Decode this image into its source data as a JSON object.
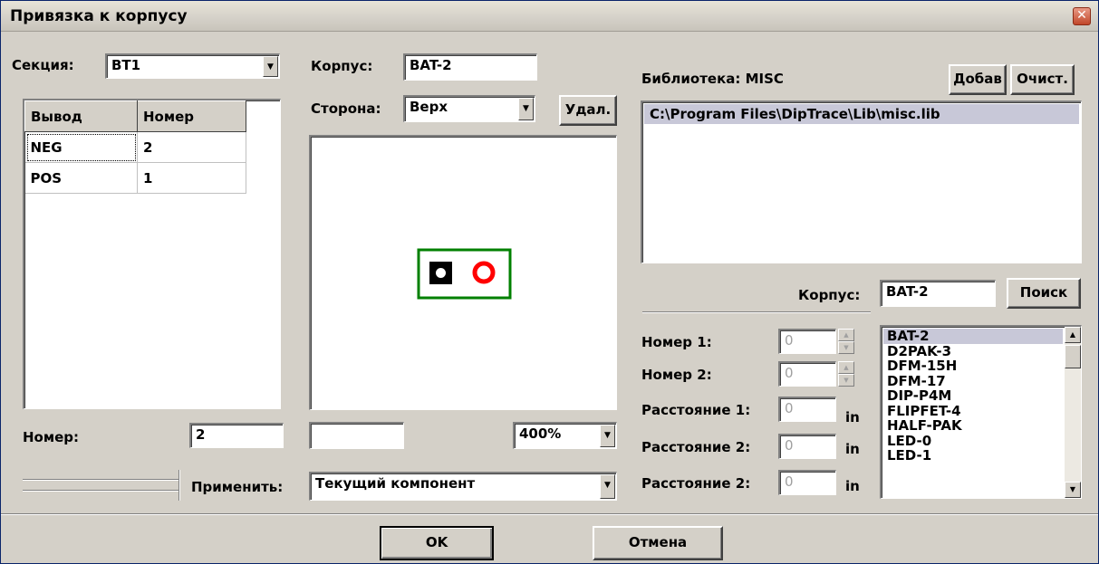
{
  "window": {
    "title": "Привязка к корпусу",
    "close_icon": "close-icon"
  },
  "section": {
    "label": "Секция:",
    "value": "BT1"
  },
  "pin_table": {
    "headers": [
      "Вывод",
      "Номер"
    ],
    "rows": [
      [
        "NEG",
        "2"
      ],
      [
        "POS",
        "1"
      ]
    ]
  },
  "number": {
    "label": "Номер:",
    "value": "2"
  },
  "apply": {
    "label": "Применить:",
    "value": "Текущий компонент"
  },
  "package": {
    "label": "Корпус:",
    "value": "BAT-2"
  },
  "side": {
    "label": "Сторона:",
    "value": "Верх",
    "delete_label": "Удал."
  },
  "preview": {
    "status_value": "",
    "zoom": "400%",
    "pad1_color": "#000000",
    "pad2_color": "#ff0000",
    "outline_color": "#008000"
  },
  "library": {
    "label": "Библиотека: MISC",
    "add_label": "Добав",
    "clear_label": "Очист.",
    "items": [
      "C:\\Program Files\\DipTrace\\Lib\\misc.lib"
    ]
  },
  "search": {
    "label": "Корпус:",
    "value": "BAT-2",
    "button_label": "Поиск"
  },
  "params": {
    "num1_label": "Номер 1:",
    "num1_value": "0",
    "num2_label": "Номер 2:",
    "num2_value": "0",
    "dist1_label": "Расстояние 1:",
    "dist1_value": "0",
    "dist1_unit": "in",
    "dist2_label": "Расстояние 2:",
    "dist2_value": "0",
    "dist2_unit": "in",
    "dist3_label": "Расстояние 2:",
    "dist3_value": "0",
    "dist3_unit": "in"
  },
  "package_list": [
    "BAT-2",
    "D2PAK-3",
    "DFM-15H",
    "DFM-17",
    "DIP-P4M",
    "FLIPFET-4",
    "HALF-PAK",
    "LED-0",
    "LED-1"
  ],
  "footer": {
    "ok_label": "OK",
    "cancel_label": "Отмена"
  }
}
